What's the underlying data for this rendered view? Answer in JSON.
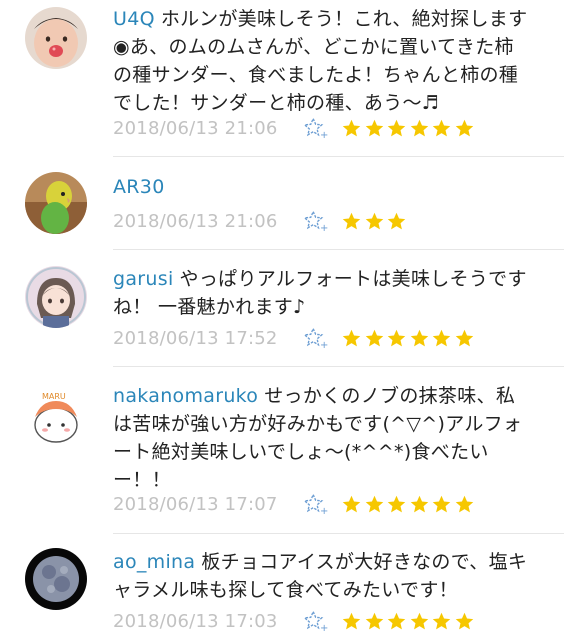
{
  "colors": {
    "username": "#2b86b9",
    "timestamp": "#c2c2c2",
    "star": "#f6c700",
    "fav_outline": "#6d9ed3",
    "text": "#222222"
  },
  "comments": [
    {
      "username": "U4Q",
      "text": "ホルンが美味しそう！これ、絶対探します◉あ、のムのムさんが、どこかに置いてきた柿の種サンダー、食べましたよ！ちゃんと柿の種でした！サンダーと柿の種、あう〜♬",
      "timestamp": "2018/06/13 21:06",
      "stars": 6,
      "avatar": "baby-photo"
    },
    {
      "username": "AR30",
      "text": "",
      "timestamp": "2018/06/13 21:06",
      "stars": 3,
      "avatar": "parakeet-photo"
    },
    {
      "username": "garusi",
      "text": "やっぱりアルフォートは美味しそうですね！ 一番魅かれます♪",
      "timestamp": "2018/06/13 17:52",
      "stars": 6,
      "avatar": "anime-girl-drawing"
    },
    {
      "username": "nakanomaruko",
      "text": "せっかくのノブの抹茶味、私は苦味が強い方が好みかもです(^▽^)アルフォート絶対美味しいでしょ〜(*^^*)食べたいー！！",
      "timestamp": "2018/06/13 17:07",
      "stars": 6,
      "avatar": "maru-character"
    },
    {
      "username": "ao_mina",
      "text": "板チョコアイスが大好きなので、塩キャラメル味も探して食べてみたいです！",
      "timestamp": "2018/06/13 17:03",
      "stars": 6,
      "avatar": "moon-photo"
    }
  ]
}
